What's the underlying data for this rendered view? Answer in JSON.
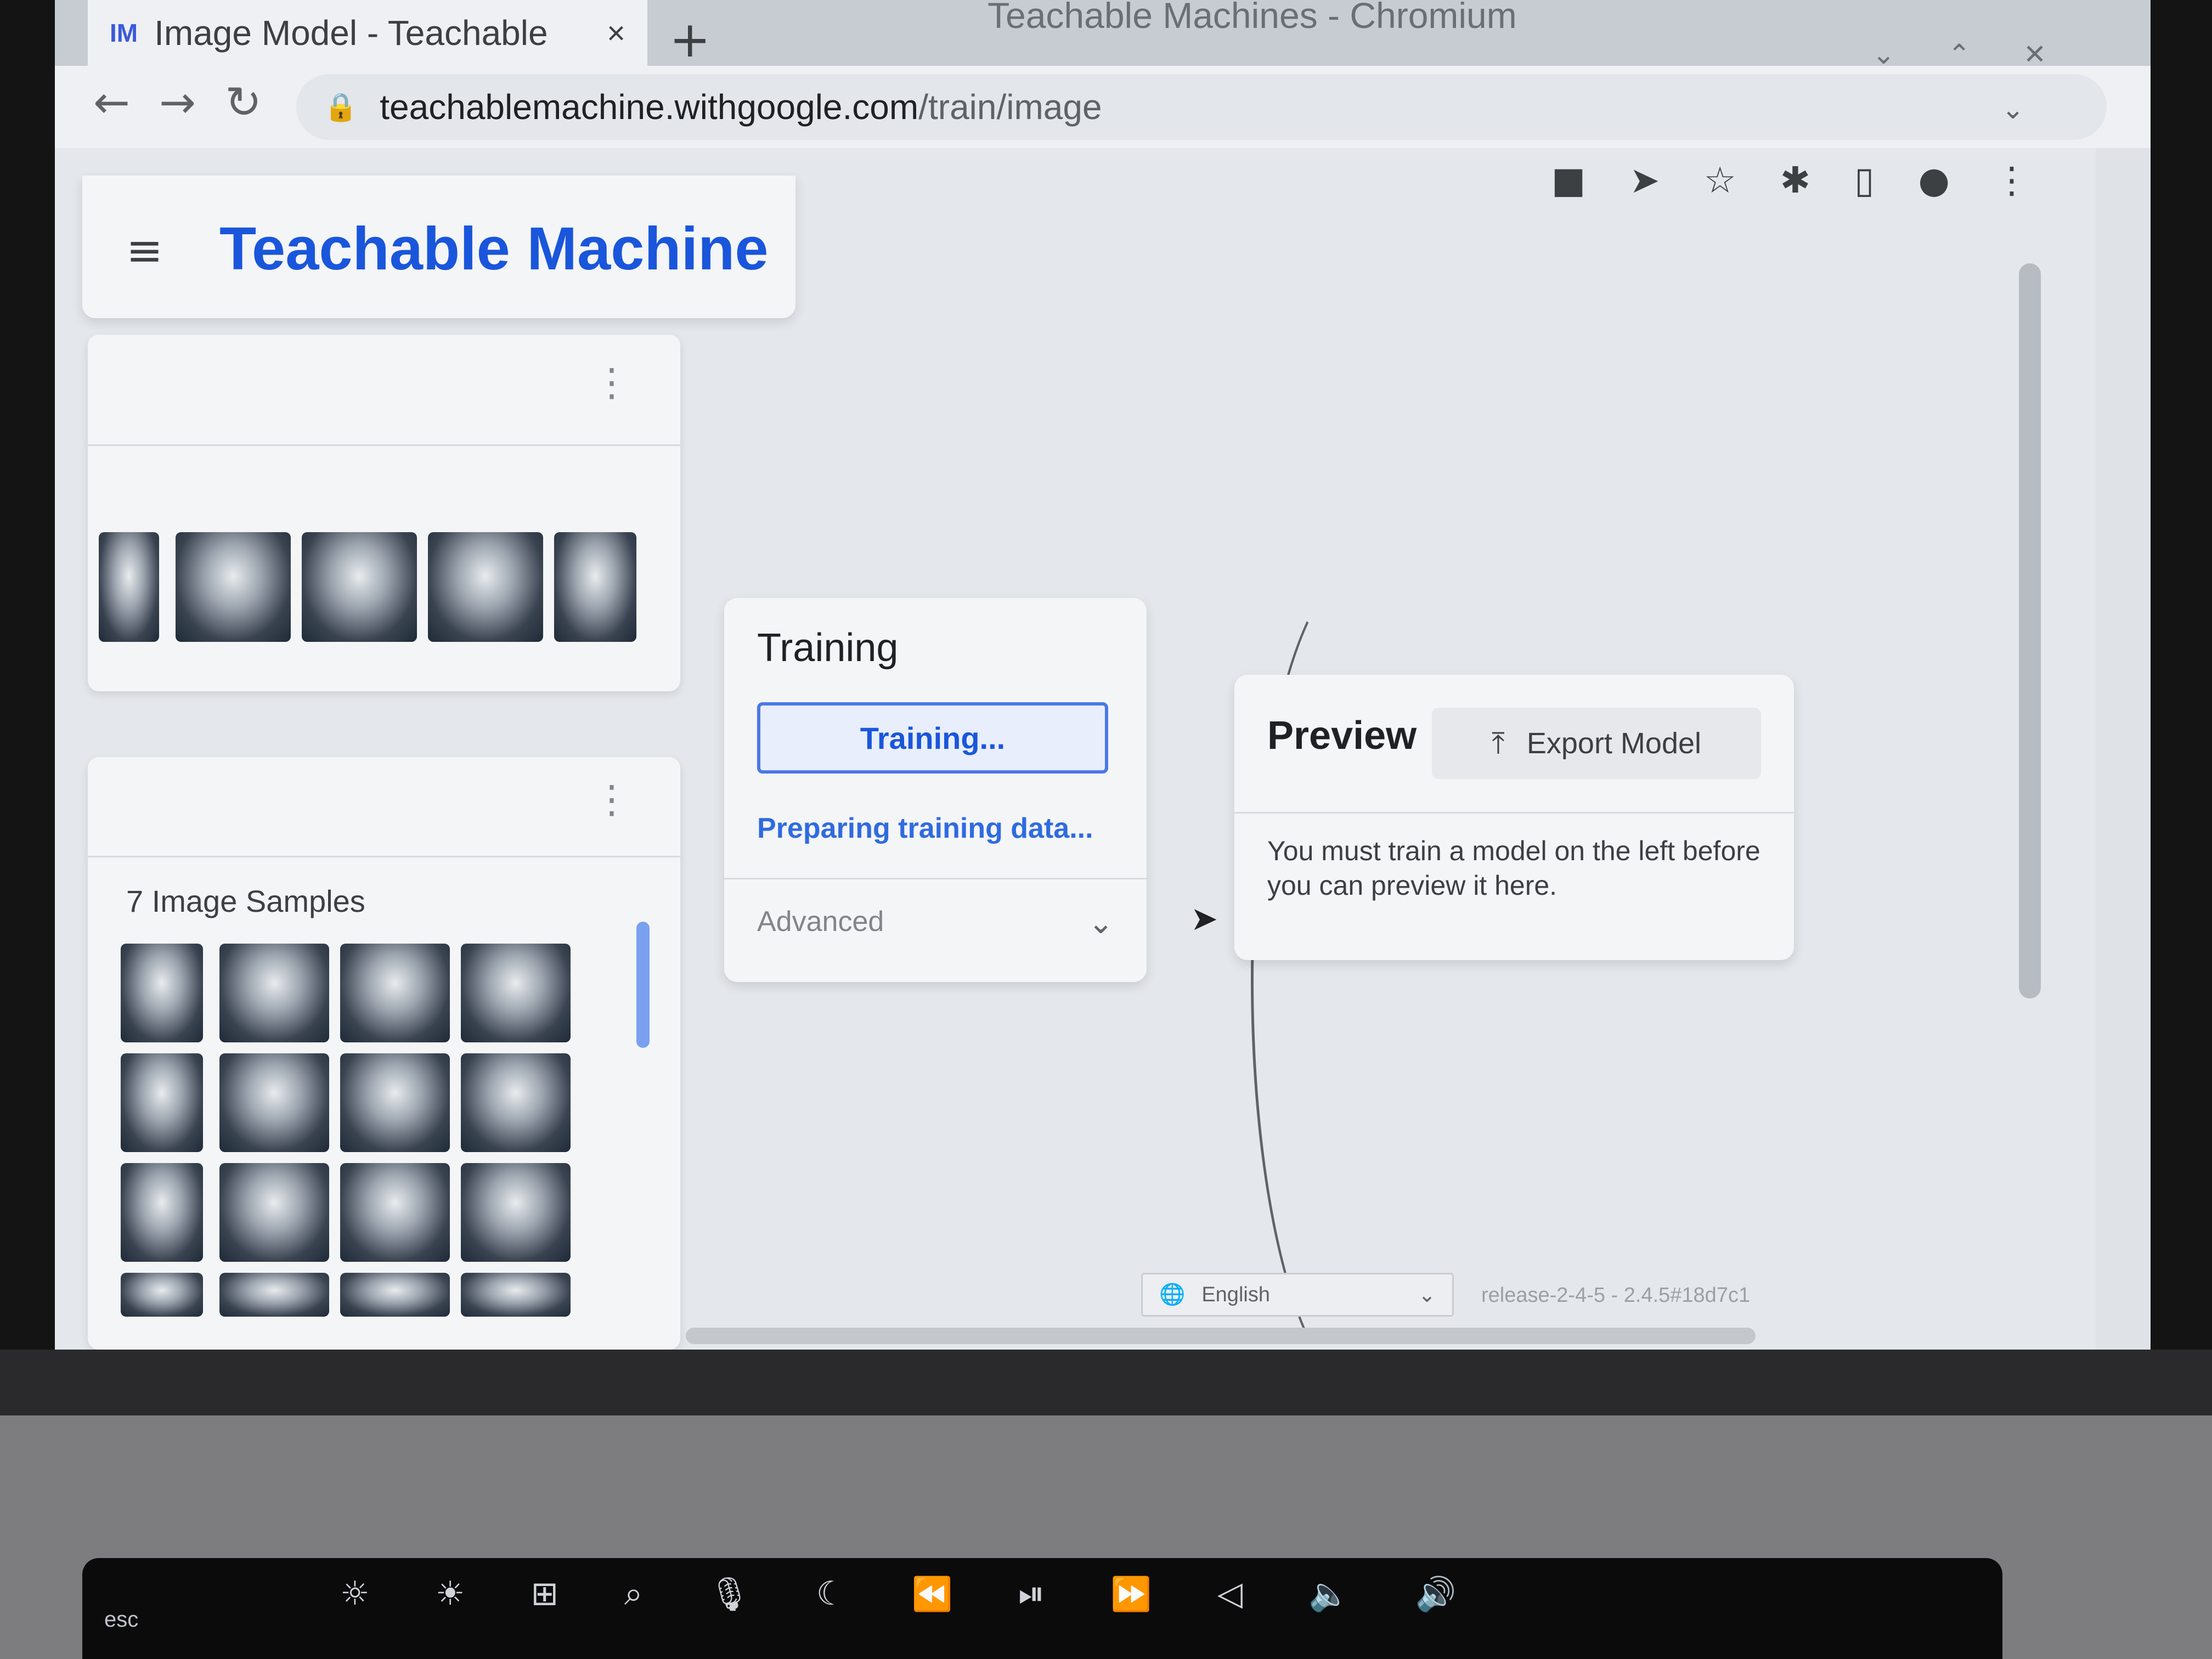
{
  "browser": {
    "tab_favicon": "IM",
    "tab_title": "Image Model - Teachable",
    "tab_close": "×",
    "new_tab": "+",
    "window_title": "Teachable Machines - Chromium",
    "url_host": "teachablemachine.withgoogle.com",
    "url_path": "/train/image",
    "icons": [
      "video-camera-icon",
      "send-icon",
      "star-icon",
      "extensions-icon",
      "side-panel-icon",
      "profile-icon",
      "more-icon"
    ]
  },
  "header": {
    "brand": "Teachable Machine"
  },
  "classes": [
    {
      "label": ""
    },
    {
      "label": "7 Image Samples"
    }
  ],
  "training": {
    "heading": "Training",
    "button_label": "Training...",
    "status": "Preparing training data...",
    "advanced_label": "Advanced"
  },
  "preview": {
    "heading": "Preview",
    "export_label": "Export Model",
    "message": "You must train a model on the left before you can preview it here."
  },
  "footer": {
    "language": "English",
    "release": "release-2-4-5 - 2.4.5#18d7c1"
  },
  "touchbar": {
    "esc_label": "esc",
    "keys": [
      "☼",
      "☀",
      "⊞",
      "⌕",
      "🎙",
      "☾",
      "⏪",
      "⏯",
      "⏩",
      "◁",
      "🔈",
      "🔊"
    ]
  },
  "colors": {
    "brand_blue": "#1a56db",
    "accent_blue": "#4a78e6"
  }
}
